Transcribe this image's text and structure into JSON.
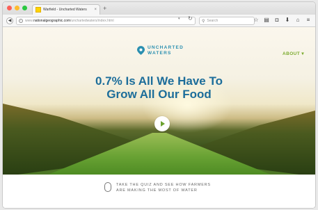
{
  "browser": {
    "tab_title": "Warfield - Uncharted Waters",
    "tab_close": "×",
    "new_tab": "+",
    "url_prefix": "www.",
    "url_domain": "nationalgeographic.com",
    "url_path": "/unchartedwaters/index.html",
    "search_placeholder": "Search",
    "icons": [
      "star-icon",
      "reading-list-icon",
      "pocket-icon",
      "download-icon",
      "home-icon",
      "menu-icon"
    ]
  },
  "site": {
    "logo_line1": "UNCHARTED",
    "logo_line2": "WATERS",
    "nav_about": "ABOUT ▾",
    "headline_line1": "0.7% Is All We Have To",
    "headline_line2": "Grow All Our Food",
    "quiz_line1": "TAKE THE QUIZ AND SEE HOW FARMERS",
    "quiz_line2": "ARE MAKING THE MOST OF WATER"
  },
  "colors": {
    "brand_blue": "#2a8fb0",
    "headline_blue": "#1c6d9a",
    "accent_green": "#7bab2d"
  }
}
